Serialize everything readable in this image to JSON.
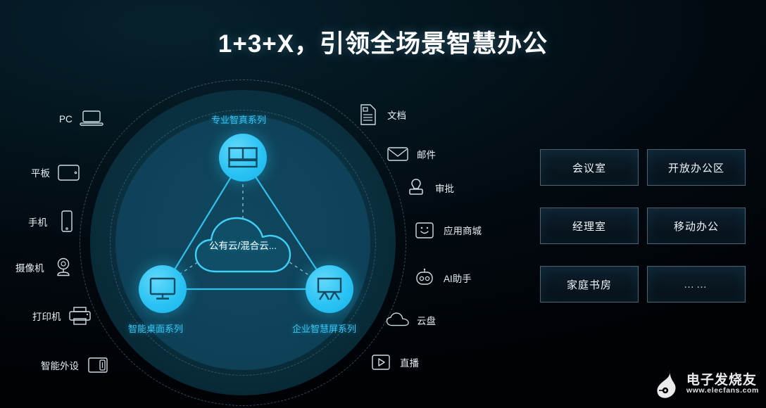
{
  "title": "1+3+X，引领全场景智慧办公",
  "hub": {
    "cloud_label": "公有云/混合云...",
    "nodes": [
      {
        "label": "专业智真系列",
        "icon": "telepresence-screen-icon"
      },
      {
        "label": "智能桌面系列",
        "icon": "desktop-monitor-icon"
      },
      {
        "label": "企业智慧屏系列",
        "icon": "smart-board-icon"
      }
    ]
  },
  "devices": [
    {
      "label": "PC",
      "icon": "laptop-icon"
    },
    {
      "label": "平板",
      "icon": "tablet-icon"
    },
    {
      "label": "手机",
      "icon": "phone-icon"
    },
    {
      "label": "摄像机",
      "icon": "camera-icon"
    },
    {
      "label": "打印机",
      "icon": "printer-icon"
    },
    {
      "label": "智能外设",
      "icon": "smart-peripheral-icon"
    }
  ],
  "services": [
    {
      "label": "文档",
      "icon": "document-icon"
    },
    {
      "label": "邮件",
      "icon": "mail-icon"
    },
    {
      "label": "审批",
      "icon": "stamp-approval-icon"
    },
    {
      "label": "应用商城",
      "icon": "app-store-icon"
    },
    {
      "label": "AI助手",
      "icon": "robot-icon"
    },
    {
      "label": "云盘",
      "icon": "cloud-drive-icon"
    },
    {
      "label": "直播",
      "icon": "live-play-icon"
    }
  ],
  "scenarios": [
    "会议室",
    "开放办公区",
    "经理室",
    "移动办公",
    "家庭书房",
    "……"
  ],
  "watermark": {
    "name": "电子发烧友",
    "url": "www.elecfans.com"
  },
  "colors": {
    "accent": "#29c4f5",
    "background": "#020a10",
    "ring": "#0e4157",
    "text": "#e8f2f6"
  }
}
